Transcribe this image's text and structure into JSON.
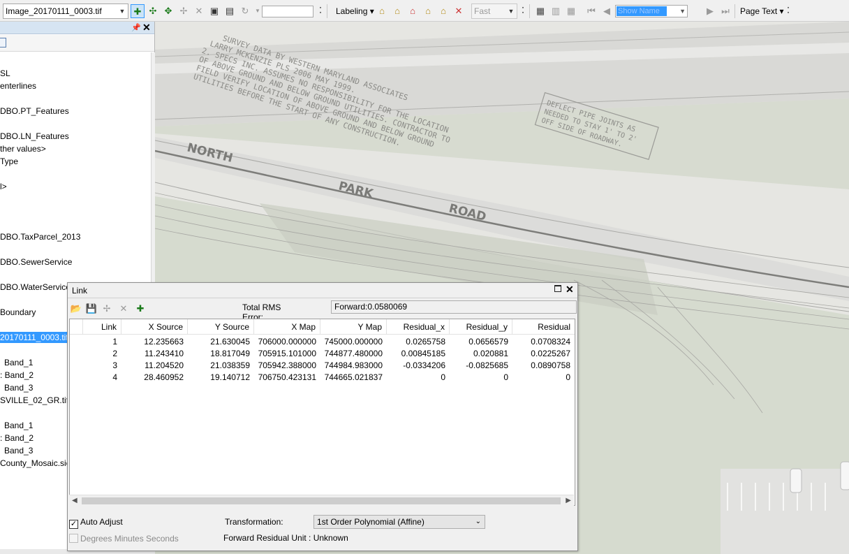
{
  "toolbar": {
    "layer_combo": "Image_20170111_0003.tif",
    "scale_value": "",
    "labeling_label": "Labeling",
    "quality_combo": "Fast",
    "snap_combo": "Show Name",
    "page_text_label": "Page Text"
  },
  "toc": {
    "items": [
      {
        "label": "SL"
      },
      {
        "label": "enterlines"
      },
      {
        "label": "DBO.PT_Features"
      },
      {
        "label": "DBO.LN_Features"
      },
      {
        "label": "ther values>"
      },
      {
        "label": "Type"
      },
      {
        "label": "l>"
      },
      {
        "label": "DBO.TaxParcel_2013"
      },
      {
        "label": "DBO.SewerService"
      },
      {
        "label": "DBO.WaterService"
      },
      {
        "label": "Boundary"
      },
      {
        "label": "20170111_0003.tif"
      },
      {
        "label": "Band_1"
      },
      {
        "label": ": Band_2"
      },
      {
        "label": "Band_3"
      },
      {
        "label": "SVILLE_02_GR.tif"
      },
      {
        "label": "Band_1"
      },
      {
        "label": ": Band_2"
      },
      {
        "label": "Band_3"
      },
      {
        "label": "County_Mosaic.sic"
      }
    ]
  },
  "map": {
    "notes": [
      "SURVEY DATA BY WESTERN MARYLAND ASSOCIATES",
      "LARRY MCKENZIE PLS 2006 MAY 1999.",
      "2. SPECS INC. ASSUMES NO RESPONSIBILITY FOR THE LOCATION",
      "OF ABOVE GROUND AND BELOW GROUND UTILITIES. CONTRACTOR TO",
      "FIELD VERIFY LOCATION OF ABOVE GROUND AND BELOW GROUND",
      "UTILITIES BEFORE THE START OF ANY CONSTRUCTION."
    ],
    "road_words": [
      "NORTH",
      "PARK",
      "ROAD"
    ],
    "deflect_note": [
      "DEFLECT PIPE JOINTS AS",
      "NEEDED TO STAY 1' TO 2'",
      "OFF SIDE OF ROADWAY."
    ]
  },
  "link_dialog": {
    "title": "Link",
    "rms_label": "Total RMS Error:",
    "rms_value": "Forward:0.0580069",
    "columns": [
      "Link",
      "X Source",
      "Y Source",
      "X Map",
      "Y Map",
      "Residual_x",
      "Residual_y",
      "Residual"
    ],
    "rows": [
      [
        "1",
        "12.235663",
        "21.630045",
        "706000.000000",
        "745000.000000",
        "0.0265758",
        "0.0656579",
        "0.0708324"
      ],
      [
        "2",
        "11.243410",
        "18.817049",
        "705915.101000",
        "744877.480000",
        "0.00845185",
        "0.020881",
        "0.0225267"
      ],
      [
        "3",
        "11.204520",
        "21.038359",
        "705942.388000",
        "744984.983000",
        "-0.0334206",
        "-0.0825685",
        "0.0890758"
      ],
      [
        "4",
        "28.460952",
        "19.140712",
        "706750.423131",
        "744665.021837",
        "0",
        "0",
        "0"
      ]
    ],
    "auto_adjust_label": "Auto Adjust",
    "auto_adjust_checked": true,
    "dms_label": "Degrees Minutes Seconds",
    "dms_checked": false,
    "transformation_label": "Transformation:",
    "transformation_value": "1st Order Polynomial (Affine)",
    "residual_unit_text": "Forward Residual Unit : Unknown"
  }
}
